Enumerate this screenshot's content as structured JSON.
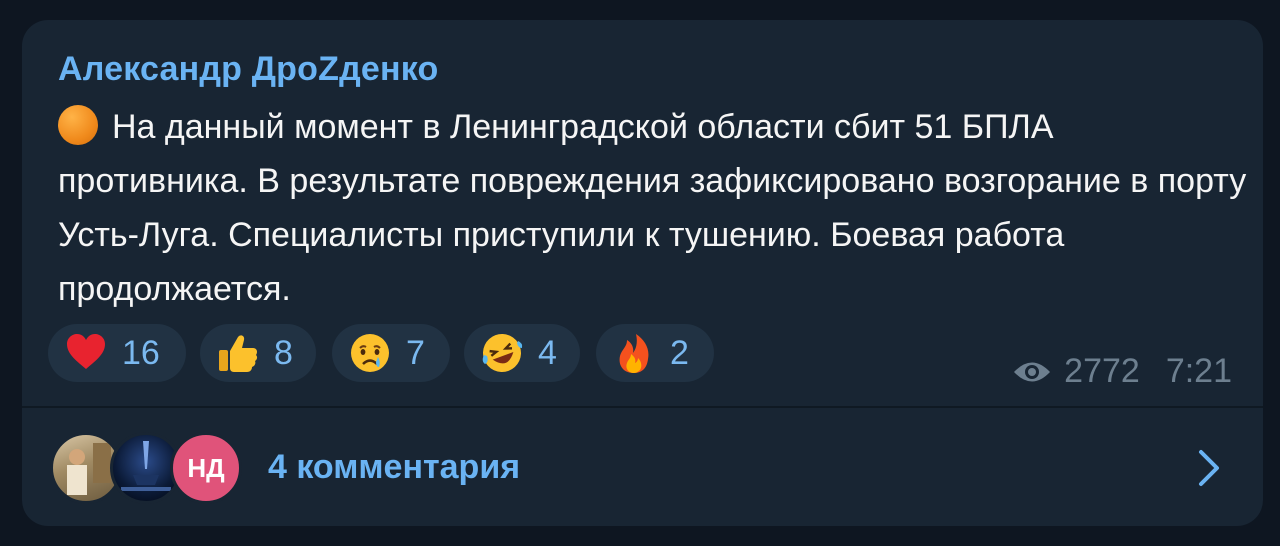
{
  "post": {
    "author": "Александр ДроZденко",
    "status_icon": "orange-circle-icon",
    "text": "На данный момент в Ленинградской области сбит 51 БПЛА противника. В результате повреждения зафиксировано возгорание в порту Усть-Луга. Специалисты приступили к тушению. Боевая работа продолжается.",
    "reactions": [
      {
        "icon": "heart-icon",
        "count": "16"
      },
      {
        "icon": "thumbs-up-icon",
        "count": "8"
      },
      {
        "icon": "crying-face-icon",
        "count": "7"
      },
      {
        "icon": "laughing-face-icon",
        "count": "4"
      },
      {
        "icon": "fire-icon",
        "count": "2"
      }
    ],
    "views": "2772",
    "time": "7:21"
  },
  "comments": {
    "avatars": [
      {
        "name": "avatar-1",
        "initials": ""
      },
      {
        "name": "avatar-2",
        "initials": ""
      },
      {
        "name": "avatar-3",
        "initials": "НД"
      }
    ],
    "label": "4 комментария"
  },
  "colors": {
    "background": "#0e1621",
    "bubble": "#182533",
    "accent": "#6ab3f3",
    "reaction_bg": "#213243",
    "meta": "#6d7f8f"
  }
}
